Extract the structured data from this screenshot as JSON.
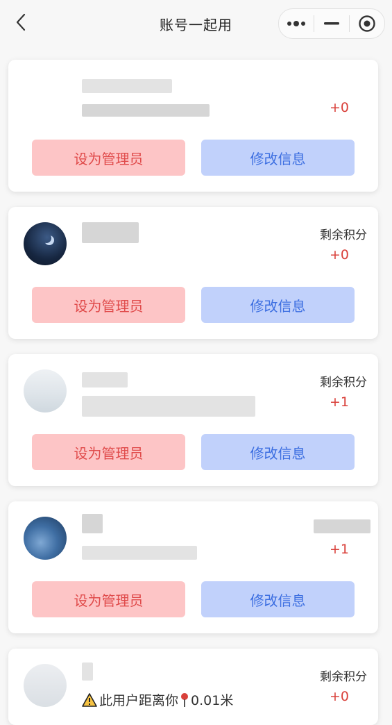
{
  "nav": {
    "title": "账号一起用"
  },
  "buttons": {
    "set_admin": "设为管理员",
    "edit_info": "修改信息"
  },
  "points_label": "剩余积分",
  "members": [
    {
      "points": "+0"
    },
    {
      "points": "+0"
    },
    {
      "points": "+1"
    },
    {
      "points": "+1"
    },
    {
      "points": "+0",
      "distance_text": "此用户距离你",
      "distance_value": "0.01米"
    }
  ],
  "colors": {
    "admin_bg": "#fdc5c6",
    "admin_text": "#e04b4b",
    "edit_bg": "#c1d1fb",
    "edit_text": "#3d6fe1",
    "points": "#d9403a"
  },
  "icons": [
    "back-chevron-icon",
    "more-dots-icon",
    "minimize-icon",
    "close-target-icon",
    "warning-icon",
    "location-pin-icon"
  ]
}
